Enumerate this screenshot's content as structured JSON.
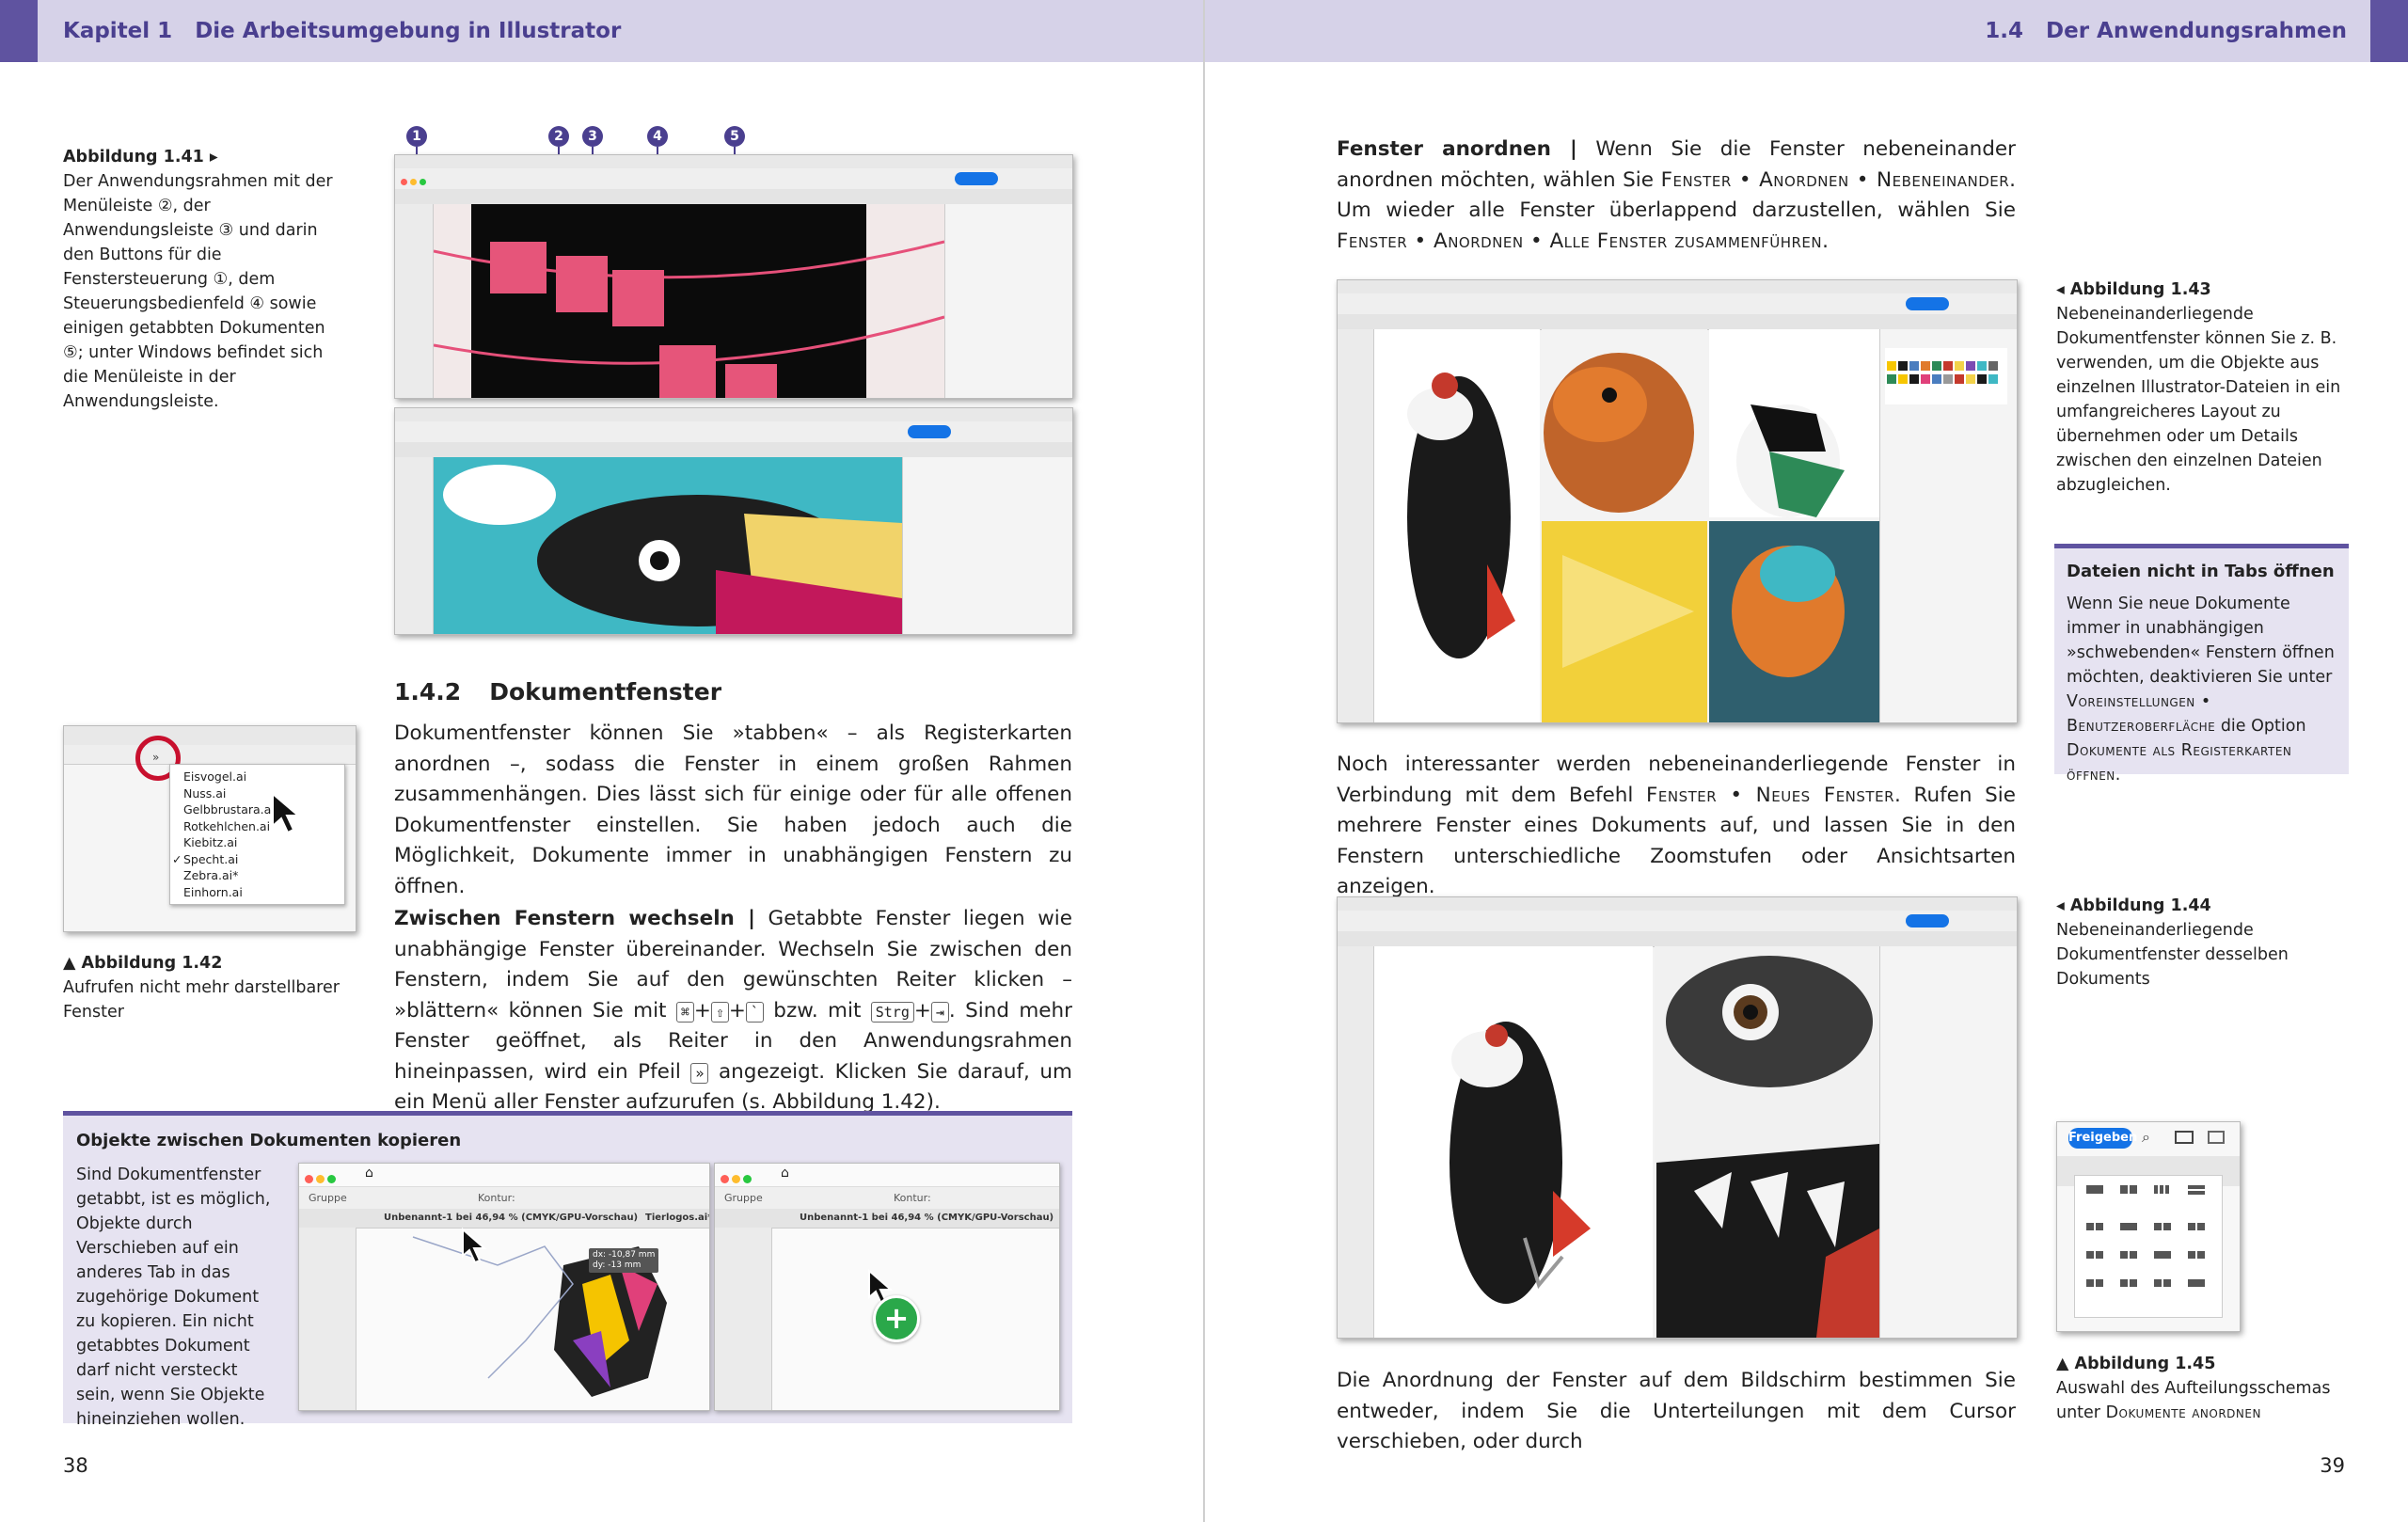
{
  "left": {
    "header": "Kapitel 1   Die Arbeitsumgebung in Illustrator",
    "fig141": {
      "title": "Abbildung 1.41 ▸",
      "text": "Der Anwendungsrahmen mit der Menüleiste ②, der Anwendungsleiste ③ und darin den Buttons für die Fenstersteuerung ①, dem Steuerungsbedienfeld ④ sowie einigen getabbten Dokumenten ⑤; unter Windows befindet sich die Menüleiste in der Anwendungsleiste."
    },
    "callouts": [
      "1",
      "2",
      "3",
      "4",
      "5"
    ],
    "fig142": {
      "title": "▲ Abbildung 1.42",
      "text": "Aufrufen nicht mehr darstellbarer Fenster",
      "menu_items": [
        "Eisvogel.ai",
        "Nuss.ai",
        "Gelbbrustara.ai",
        "Rotkehlchen.ai",
        "Kiebitz.ai",
        "Specht.ai",
        "Zebra.ai*",
        "Einhorn.ai"
      ],
      "checked": "✓"
    },
    "section_number": "1.4.2",
    "section_title": "Dokumentfenster",
    "para1": "Dokumentfenster können Sie »tabben« – als Registerkarten anordnen –, sodass die Fenster in einem großen Rahmen zusammenhängen. Dies lässt sich für einige oder für alle offenen Dokumentfenster einstellen. Sie haben jedoch auch die Möglichkeit, Dokumente immer in unabhängigen Fenstern zu öffnen.",
    "para2_head": "Zwischen Fenstern wechseln |",
    "para2_a": " Getabbte Fenster liegen wie unabhängige Fenster übereinander. Wechseln Sie zwischen den Fenstern, indem Sie auf den gewünschten Reiter klicken – »blättern« können Sie mit ",
    "keys1": [
      "⌘",
      "⇧",
      "`"
    ],
    "para2_b": " bzw. mit ",
    "keys2": [
      "Strg",
      "⇥"
    ],
    "para2_c": ". Sind mehr Fenster geöffnet, als Reiter in den Anwendungsrahmen hineinpassen, wird ein Pfeil ",
    "arrow_key": "»",
    "para2_d": " angezeigt. Klicken Sie darauf, um ein Menü aller Fenster aufzurufen (s. Abbildung 1.42).",
    "box": {
      "title": "Objekte zwischen Dokumenten kopieren",
      "text": "Sind Dokumentfenster getabbt, ist es möglich, Objekte durch Verschieben auf ein anderes Tab in das zugehörige Dokument zu kopieren. Ein nicht getabbtes Dokument darf nicht versteckt sein, wenn Sie Objekte hineinziehen wollen.",
      "shot1_tab1": "Unbenannt-1 bei 46,94 % (CMYK/GPU-Vorschau)",
      "shot1_tab2": "Tierlogos.ai*",
      "shot1_group": "Gruppe",
      "shot1_kontur": "Kontur:",
      "shot1_dx": "dx: -10,87 mm",
      "shot1_dy": "dy: -13 mm",
      "shot2_tab": "Unbenannt-1 bei 46,94 % (CMYK/GPU-Vorschau)",
      "shot2_group": "Gruppe",
      "shot2_kontur": "Kontur:",
      "plus": "+"
    },
    "page_number": "38"
  },
  "right": {
    "header": "1.4   Der Anwendungsrahmen",
    "para1_head": "Fenster anordnen |",
    "para1_a": " Wenn Sie die Fenster nebeneinander anordnen möchten, wählen Sie ",
    "para1_path1": "Fenster • Anordnen • Nebeneinander",
    "para1_b": ". Um wieder alle Fenster überlappend darzustellen, wählen Sie ",
    "para1_path2": "Fenster • Anordnen • Alle Fenster zusammenführen",
    "para1_c": ".",
    "fig143": {
      "title": "◂ Abbildung 1.43",
      "text": "Nebeneinanderliegende Dokumentfenster können Sie z. B. verwenden, um die Objekte aus einzelnen Illustrator-Dateien in ein umfangreicheres Layout zu übernehmen oder um Details zwischen den einzelnen Dateien abzugleichen."
    },
    "infobox": {
      "title": "Dateien nicht in Tabs öffnen",
      "text_a": "Wenn Sie neue Dokumente immer in unabhängigen »schwebenden« Fenstern öffnen möchten, deaktivieren Sie unter ",
      "path": "Voreinstellungen • Benutzeroberfläche",
      "text_b": " die Option ",
      "option": "Dokumente als Registerkarten öffnen",
      "text_c": "."
    },
    "para2_a": "Noch interessanter werden nebeneinanderliegende Fenster in Verbindung mit dem Befehl ",
    "para2_path": "Fenster • Neues Fenster",
    "para2_b": ". Rufen Sie mehrere Fenster eines Dokuments auf, und lassen Sie in den Fenstern unterschiedliche Zoomstufen oder Ansichtsarten anzeigen.",
    "fig144": {
      "title": "◂ Abbildung 1.44",
      "text": "Nebeneinanderliegende Dokumentfenster desselben Dokuments"
    },
    "fig145": {
      "title": "▲ Abbildung 1.45",
      "text_a": "Auswahl des Aufteilungsschemas unter ",
      "path": "Dokumente anordnen",
      "button": "Freigeben"
    },
    "para3": "Die Anordnung der Fenster auf dem Bildschirm bestimmen Sie entweder, indem Sie die Unterteilungen mit dem Cursor verschieben, oder durch",
    "page_number": "39"
  },
  "colors": {
    "accent": "#5f53a0",
    "band": "#d6d2e8",
    "infobox": "#e6e3f1",
    "callout": "#4a3f8f",
    "ui_blue": "#1473e6"
  }
}
